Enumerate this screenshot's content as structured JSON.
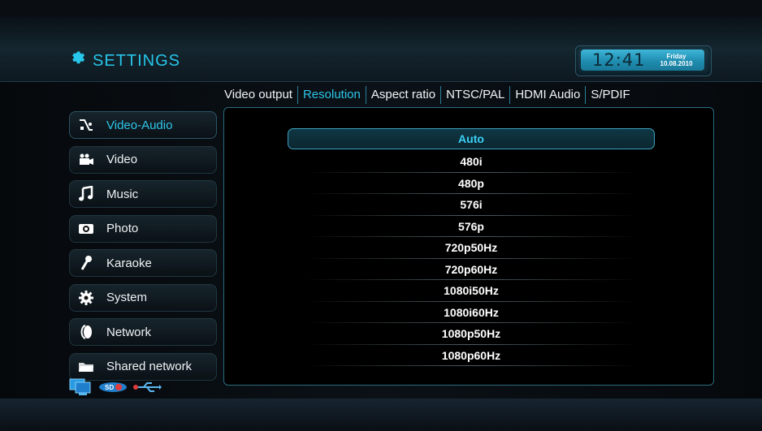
{
  "header": {
    "title": "SETTINGS",
    "clock": {
      "time": "12:41",
      "day": "Friday",
      "date": "10.08.2010"
    }
  },
  "tabs": [
    {
      "label": "Video output",
      "active": false
    },
    {
      "label": "Resolution",
      "active": true
    },
    {
      "label": "Aspect ratio",
      "active": false
    },
    {
      "label": "NTSC/PAL",
      "active": false
    },
    {
      "label": "HDMI Audio",
      "active": false
    },
    {
      "label": "S/PDIF",
      "active": false
    }
  ],
  "sidebar": {
    "items": [
      {
        "label": "Video-Audio",
        "icon": "video-audio-icon",
        "active": true
      },
      {
        "label": "Video",
        "icon": "camera-icon",
        "active": false
      },
      {
        "label": "Music",
        "icon": "music-note-icon",
        "active": false
      },
      {
        "label": "Photo",
        "icon": "photo-icon",
        "active": false
      },
      {
        "label": "Karaoke",
        "icon": "microphone-icon",
        "active": false
      },
      {
        "label": "System",
        "icon": "gear-icon",
        "active": false
      },
      {
        "label": "Network",
        "icon": "network-icon",
        "active": false
      },
      {
        "label": "Shared network",
        "icon": "folder-icon",
        "active": false
      }
    ]
  },
  "resolutions": {
    "selected": "Auto",
    "options": [
      "Auto",
      "480i",
      "480p",
      "576i",
      "576p",
      "720p50Hz",
      "720p60Hz",
      "1080i50Hz",
      "1080i60Hz",
      "1080p50Hz",
      "1080p60Hz"
    ]
  },
  "status_icons": [
    "computer-icon",
    "sd-card-icon",
    "usb-icon"
  ],
  "colors": {
    "accent": "#2ec6ea",
    "text": "#ffffff",
    "panel_border": "#2a6b80"
  }
}
